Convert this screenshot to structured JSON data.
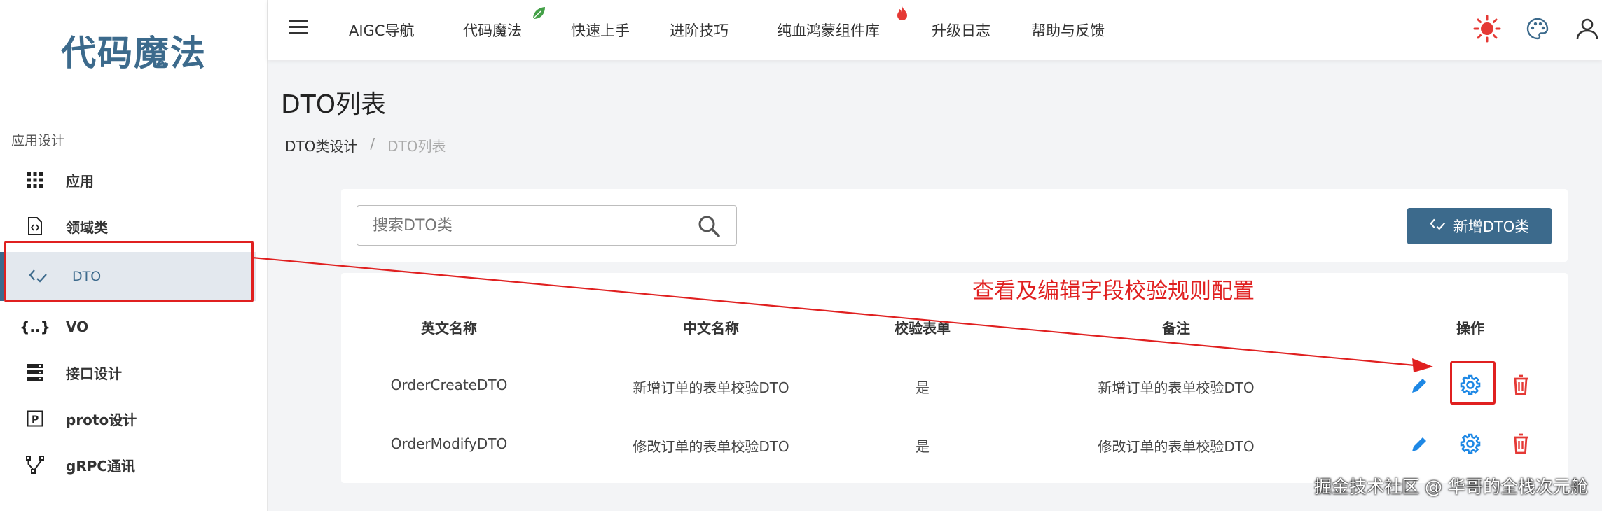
{
  "sidebar": {
    "logo": "代码魔法",
    "section_title": "应用设计",
    "items": [
      {
        "label": "应用",
        "icon": "grid-icon"
      },
      {
        "label": "领域类",
        "icon": "code-file-icon"
      },
      {
        "label": "DTO",
        "icon": "dto-icon"
      },
      {
        "label": "VO",
        "icon": "braces-icon"
      },
      {
        "label": "接口设计",
        "icon": "server-icon"
      },
      {
        "label": "proto设计",
        "icon": "p-box-icon"
      },
      {
        "label": "gRPC通讯",
        "icon": "branch-icon"
      }
    ],
    "active_index": 2
  },
  "topnav": {
    "items": [
      "AIGC导航",
      "代码魔法",
      "快速上手",
      "进阶技巧",
      "纯血鸿蒙组件库",
      "升级日志",
      "帮助与反馈"
    ],
    "badges": {
      "leaf": "leaf-icon",
      "fire": "fire-icon"
    },
    "right_icons": [
      "sun-icon",
      "palette-icon",
      "user-icon"
    ]
  },
  "page": {
    "title": "DTO列表",
    "breadcrumb": [
      "DTO类设计",
      "/",
      "DTO列表"
    ]
  },
  "search": {
    "placeholder": "搜索DTO类",
    "add_button_label": "新增DTO类"
  },
  "table": {
    "headers": [
      "英文名称",
      "中文名称",
      "校验表单",
      "备注",
      "操作"
    ],
    "rows": [
      {
        "en": "OrderCreateDTO",
        "cn": "新增订单的表单校验DTO",
        "validate": "是",
        "note": "新增订单的表单校验DTO"
      },
      {
        "en": "OrderModifyDTO",
        "cn": "修改订单的表单校验DTO",
        "validate": "是",
        "note": "修改订单的表单校验DTO"
      }
    ],
    "actions": [
      "edit-icon",
      "settings-icon",
      "delete-icon"
    ]
  },
  "annotation": {
    "text": "查看及编辑字段校验规则配置",
    "color": "#e02020"
  },
  "watermark": "掘金技术社区 @ 华哥的全栈次元舱",
  "colors": {
    "brand": "#3c6a8c",
    "action_blue": "#1e88e5",
    "delete_red": "#e53935"
  }
}
